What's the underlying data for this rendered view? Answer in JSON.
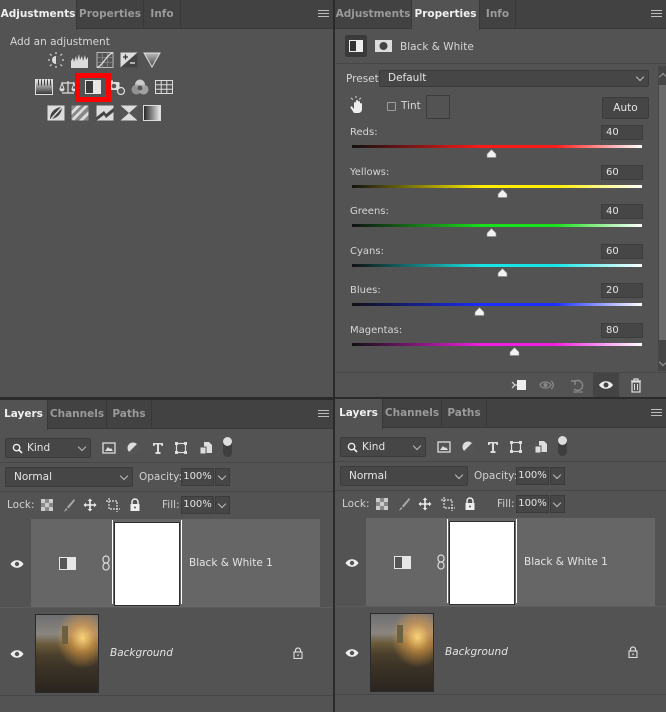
{
  "panels": {
    "top_left": {
      "tabs": [
        {
          "label": "Adjustments",
          "active": true
        },
        {
          "label": "Properties",
          "active": false
        },
        {
          "label": "Info",
          "active": false
        }
      ],
      "title": "Add an adjustment",
      "icons_row1": [
        "brightness-contrast-icon",
        "levels-icon",
        "curves-icon",
        "exposure-icon",
        "gradient-triangle-icon"
      ],
      "icons_row2": [
        "hue-saturation-icon",
        "color-balance-icon",
        "black-white-icon",
        "photo-filter-icon",
        "channel-mixer-icon",
        "color-lookup-icon"
      ],
      "icons_row3": [
        "invert-icon",
        "posterize-icon",
        "threshold-icon",
        "selective-color-icon",
        "gradient-map-icon"
      ],
      "highlighted_icon": "black-white-icon",
      "highlight_color": "#ff0000"
    },
    "top_right": {
      "tabs": [
        {
          "label": "Adjustments",
          "active": false
        },
        {
          "label": "Properties",
          "active": true
        },
        {
          "label": "Info",
          "active": false
        }
      ],
      "title": "Black & White",
      "preset_label": "Preset:",
      "preset_value": "Default",
      "tint_label": "Tint",
      "tint_checked": false,
      "auto_label": "Auto",
      "channels": [
        {
          "label": "Reds:",
          "value": "40",
          "fraction": 0.48,
          "color": "#ff1a1a",
          "end": "#ffffff"
        },
        {
          "label": "Yellows:",
          "value": "60",
          "fraction": 0.52,
          "color": "#ffee00",
          "end": "#ffffff"
        },
        {
          "label": "Greens:",
          "value": "40",
          "fraction": 0.48,
          "color": "#19e01a",
          "end": "#ffffff"
        },
        {
          "label": "Cyans:",
          "value": "60",
          "fraction": 0.52,
          "color": "#19e5e5",
          "end": "#ffffff"
        },
        {
          "label": "Blues:",
          "value": "20",
          "fraction": 0.44,
          "color": "#1a2eff",
          "end": "#ffffff"
        },
        {
          "label": "Magentas:",
          "value": "80",
          "fraction": 0.56,
          "color": "#f01ee0",
          "end": "#ffffff"
        }
      ]
    },
    "layers_left": {
      "tabs": [
        {
          "label": "Layers",
          "active": true
        },
        {
          "label": "Channels",
          "active": false
        },
        {
          "label": "Paths",
          "active": false
        }
      ],
      "filter_kind": "Kind",
      "blend_mode": "Normal",
      "opacity_label": "Opacity:",
      "opacity_value": "100%",
      "lock_label": "Lock:",
      "fill_label": "Fill:",
      "fill_value": "100%",
      "layers": [
        {
          "name": "Black & White 1",
          "type": "adjustment",
          "visible": true,
          "selected": true
        },
        {
          "name": "Background",
          "type": "image",
          "visible": true,
          "locked": true,
          "selected": false
        }
      ]
    },
    "layers_right": {
      "tabs": [
        {
          "label": "Layers",
          "active": true
        },
        {
          "label": "Channels",
          "active": false
        },
        {
          "label": "Paths",
          "active": false
        }
      ],
      "filter_kind": "Kind",
      "blend_mode": "Normal",
      "opacity_label": "Opacity:",
      "opacity_value": "100%",
      "lock_label": "Lock:",
      "fill_label": "Fill:",
      "fill_value": "100%",
      "layers": [
        {
          "name": "Black & White 1",
          "type": "adjustment",
          "visible": true,
          "selected": true
        },
        {
          "name": "Background",
          "type": "image",
          "visible": true,
          "locked": true,
          "selected": false
        }
      ]
    }
  }
}
